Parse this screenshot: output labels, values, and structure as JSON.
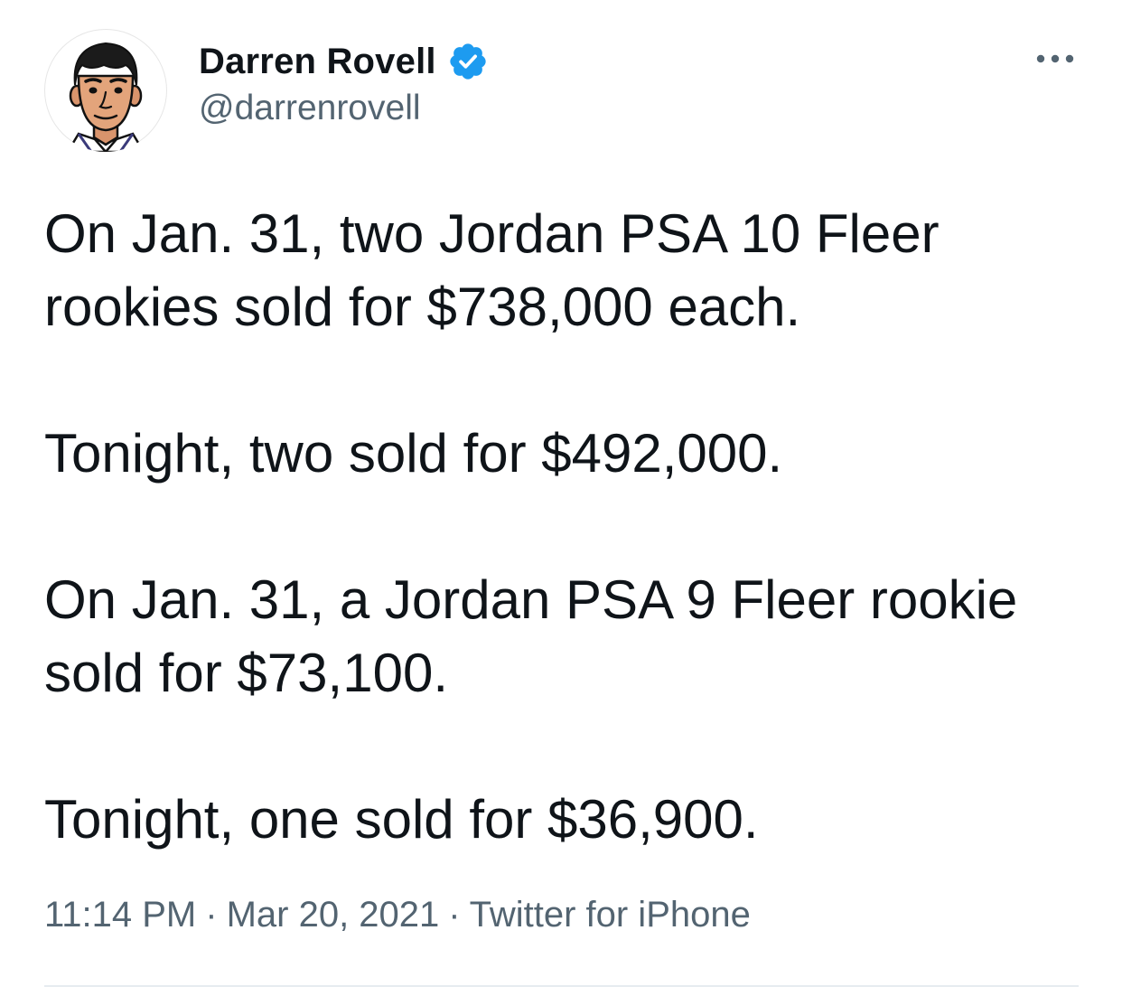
{
  "author": {
    "name": "Darren Rovell",
    "handle": "@darrenrovell",
    "verified": true,
    "avatar_icon": "cartoon-portrait-avatar"
  },
  "more_icon": "ellipsis-icon",
  "tweet": {
    "paragraphs": [
      "On Jan. 31, two Jordan PSA 10 Fleer rookies sold for $738,000 each.",
      "Tonight, two sold for $492,000.",
      "On Jan. 31, a Jordan PSA 9 Fleer rookie sold for $73,100.",
      "Tonight, one sold for $36,900."
    ]
  },
  "meta": {
    "time": "11:14 PM",
    "date": "Mar 20, 2021",
    "source": "Twitter for iPhone",
    "separator": "·"
  },
  "colors": {
    "text": "#0f1419",
    "secondary": "#536471",
    "verified_blue": "#1d9bf0",
    "divider": "#e6ecf0"
  }
}
